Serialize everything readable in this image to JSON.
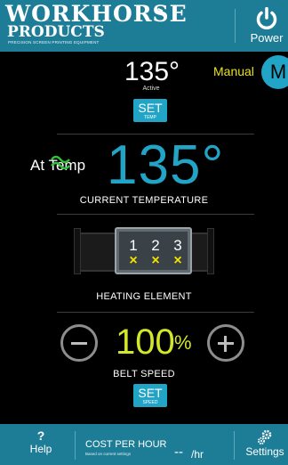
{
  "header": {
    "logo_line1": "WORKHORSE",
    "logo_line2": "PRODUCTS",
    "logo_tagline": "PRECISION SCREEN PRINTING EQUIPMENT",
    "power_label": "Power"
  },
  "set_temp": {
    "value": "135°",
    "status": "Active",
    "button_label": "SET",
    "button_sub": "TEMP"
  },
  "mode": {
    "label": "Manual",
    "badge": "M"
  },
  "current_temp": {
    "status": "At Temp",
    "value": "135°",
    "label": "CURRENT TEMPERATURE"
  },
  "heating_element": {
    "label": "HEATING ELEMENT",
    "zones": [
      {
        "num": "1",
        "state": "×"
      },
      {
        "num": "2",
        "state": "×"
      },
      {
        "num": "3",
        "state": "×"
      }
    ]
  },
  "belt_speed": {
    "value": "100",
    "unit": "%",
    "label": "BELT SPEED",
    "button_label": "SET",
    "button_sub": "SPEED"
  },
  "footer": {
    "help_icon": "?",
    "help_label": "Help",
    "cost_label": "COST PER HOUR",
    "cost_sub": "Based on current settings",
    "cost_value": "--",
    "cost_unit": "/hr",
    "settings_label": "Settings"
  },
  "colors": {
    "brand": "#1e7d96",
    "accent": "#21a4c6",
    "speed": "#d2e62a",
    "mode": "#e8e21c",
    "zone_off": "#f1e100"
  }
}
